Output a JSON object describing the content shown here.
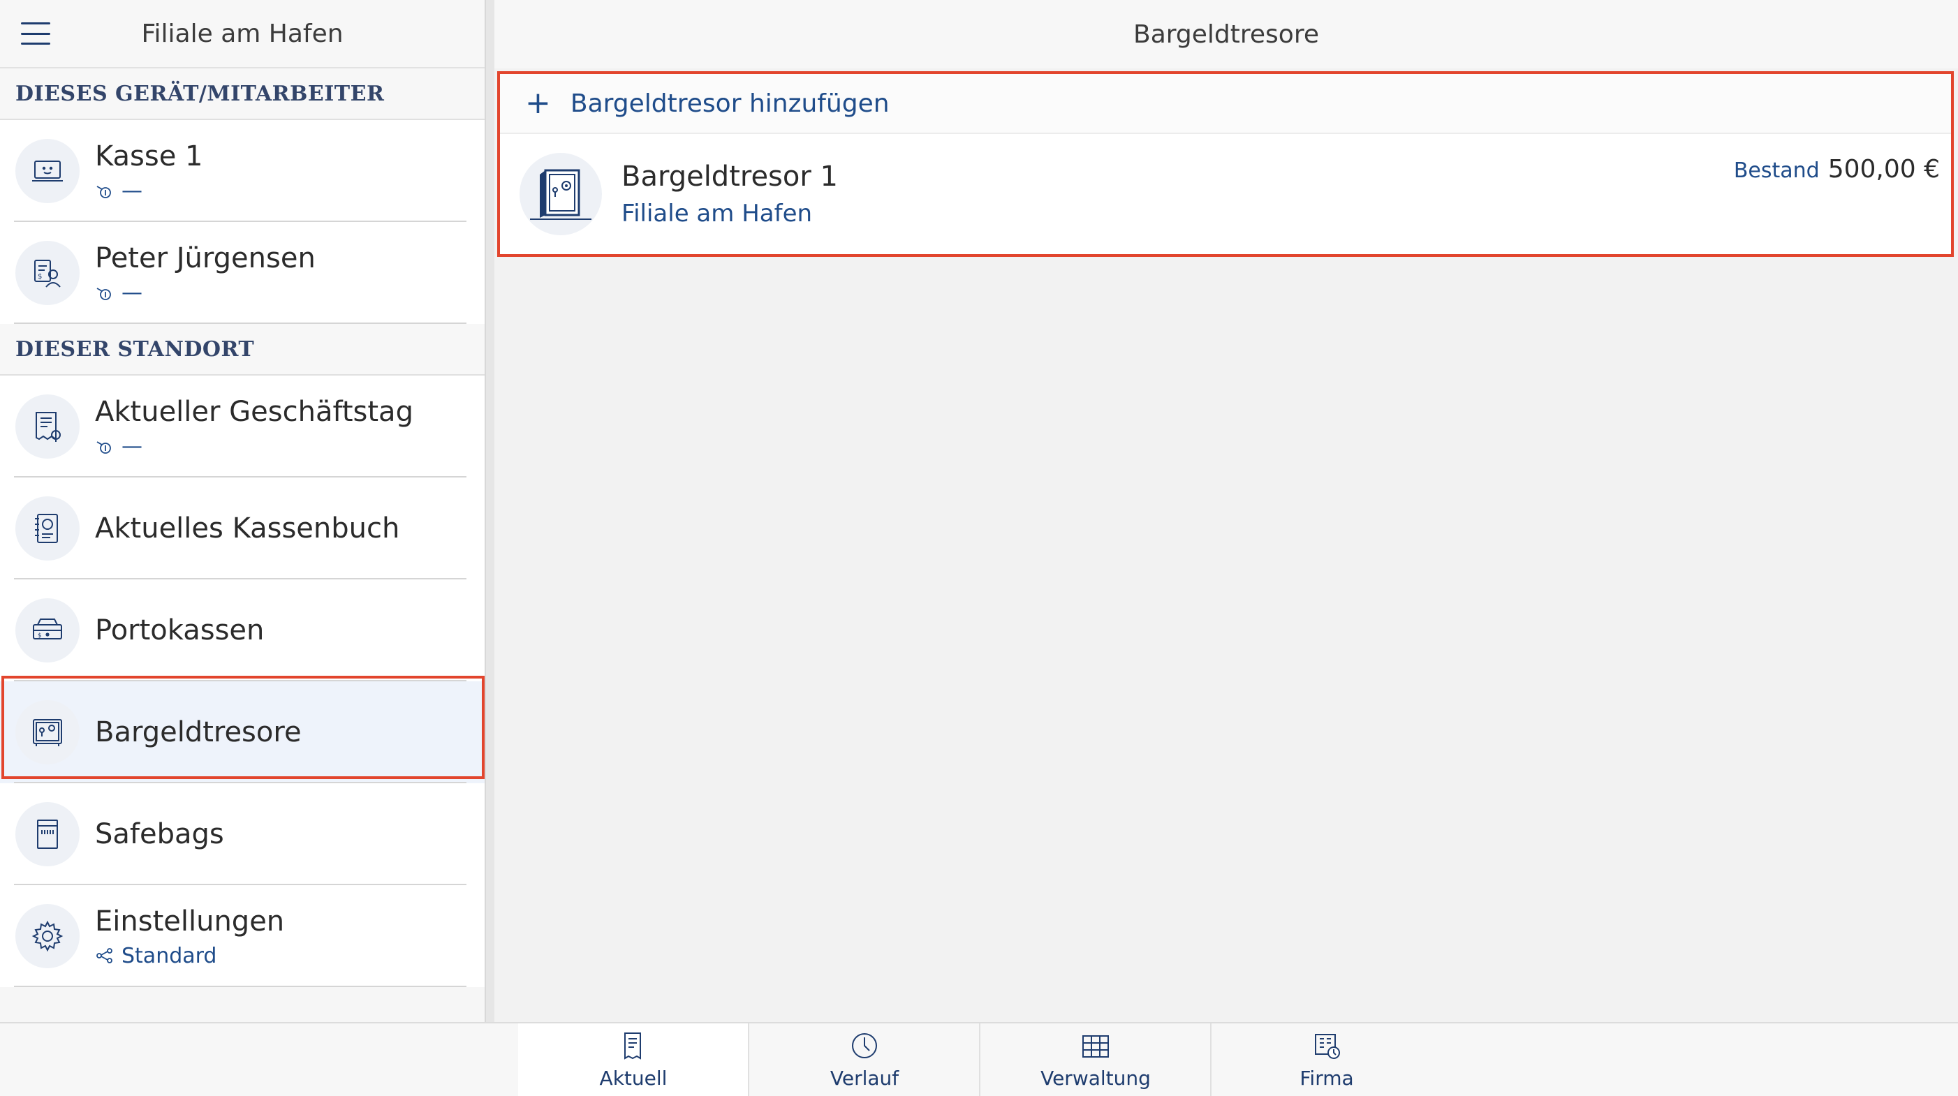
{
  "sidebar": {
    "title": "Filiale am Hafen",
    "menu_icon": "hamburger-icon",
    "sections": [
      {
        "header": "DIESES GERÄT/MITARBEITER",
        "items": [
          {
            "label": "Kasse 1",
            "icon": "register-icon",
            "sub_icon": "cash-status-icon",
            "sub_text": "—"
          },
          {
            "label": "Peter Jürgensen",
            "icon": "employee-money-icon",
            "sub_icon": "cash-status-icon",
            "sub_text": "—"
          }
        ]
      },
      {
        "header": "DIESER STANDORT",
        "items": [
          {
            "label": "Aktueller Geschäftstag",
            "icon": "business-day-icon",
            "sub_icon": "cash-status-icon",
            "sub_text": "—"
          },
          {
            "label": "Aktuelles Kassenbuch",
            "icon": "cashbook-icon"
          },
          {
            "label": "Portokassen",
            "icon": "petty-cash-icon"
          },
          {
            "label": "Bargeldtresore",
            "icon": "safe-icon",
            "selected": true
          },
          {
            "label": "Safebags",
            "icon": "safebag-icon"
          },
          {
            "label": "Einstellungen",
            "icon": "gear-icon",
            "sub_icon": "share-icon",
            "sub_text": "Standard"
          }
        ]
      }
    ]
  },
  "main": {
    "title": "Bargeldtresore",
    "add_label": "Bargeldtresor hinzufügen",
    "safes": [
      {
        "name": "Bargeldtresor 1",
        "location": "Filiale am Hafen",
        "balance_label": "Bestand",
        "balance_value": "500,00 €"
      }
    ]
  },
  "tabbar": {
    "tabs": [
      {
        "label": "Aktuell",
        "icon": "document-icon",
        "active": true
      },
      {
        "label": "Verlauf",
        "icon": "clock-icon"
      },
      {
        "label": "Verwaltung",
        "icon": "grid-icon"
      },
      {
        "label": "Firma",
        "icon": "company-icon"
      }
    ]
  },
  "colors": {
    "accent": "#1f4c8a",
    "highlight": "#e2452d",
    "selected_bg": "#eef3fb"
  }
}
